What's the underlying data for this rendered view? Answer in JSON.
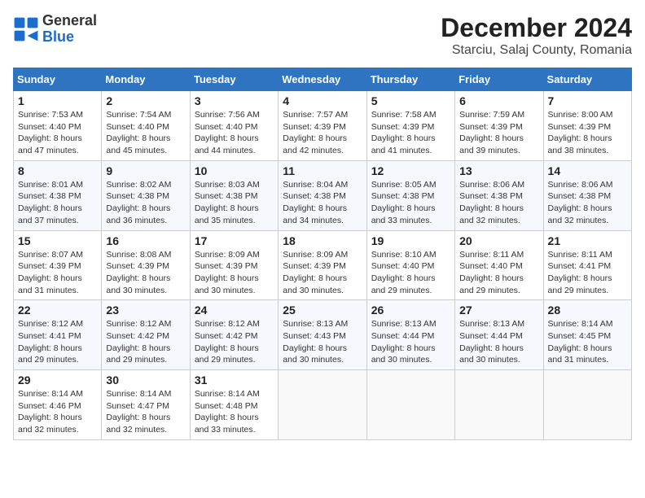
{
  "header": {
    "logo": {
      "line1": "General",
      "line2": "Blue"
    },
    "title": "December 2024",
    "subtitle": "Starciu, Salaj County, Romania"
  },
  "weekdays": [
    "Sunday",
    "Monday",
    "Tuesday",
    "Wednesday",
    "Thursday",
    "Friday",
    "Saturday"
  ],
  "weeks": [
    [
      {
        "day": 1,
        "info": "Sunrise: 7:53 AM\nSunset: 4:40 PM\nDaylight: 8 hours\nand 47 minutes."
      },
      {
        "day": 2,
        "info": "Sunrise: 7:54 AM\nSunset: 4:40 PM\nDaylight: 8 hours\nand 45 minutes."
      },
      {
        "day": 3,
        "info": "Sunrise: 7:56 AM\nSunset: 4:40 PM\nDaylight: 8 hours\nand 44 minutes."
      },
      {
        "day": 4,
        "info": "Sunrise: 7:57 AM\nSunset: 4:39 PM\nDaylight: 8 hours\nand 42 minutes."
      },
      {
        "day": 5,
        "info": "Sunrise: 7:58 AM\nSunset: 4:39 PM\nDaylight: 8 hours\nand 41 minutes."
      },
      {
        "day": 6,
        "info": "Sunrise: 7:59 AM\nSunset: 4:39 PM\nDaylight: 8 hours\nand 39 minutes."
      },
      {
        "day": 7,
        "info": "Sunrise: 8:00 AM\nSunset: 4:39 PM\nDaylight: 8 hours\nand 38 minutes."
      }
    ],
    [
      {
        "day": 8,
        "info": "Sunrise: 8:01 AM\nSunset: 4:38 PM\nDaylight: 8 hours\nand 37 minutes."
      },
      {
        "day": 9,
        "info": "Sunrise: 8:02 AM\nSunset: 4:38 PM\nDaylight: 8 hours\nand 36 minutes."
      },
      {
        "day": 10,
        "info": "Sunrise: 8:03 AM\nSunset: 4:38 PM\nDaylight: 8 hours\nand 35 minutes."
      },
      {
        "day": 11,
        "info": "Sunrise: 8:04 AM\nSunset: 4:38 PM\nDaylight: 8 hours\nand 34 minutes."
      },
      {
        "day": 12,
        "info": "Sunrise: 8:05 AM\nSunset: 4:38 PM\nDaylight: 8 hours\nand 33 minutes."
      },
      {
        "day": 13,
        "info": "Sunrise: 8:06 AM\nSunset: 4:38 PM\nDaylight: 8 hours\nand 32 minutes."
      },
      {
        "day": 14,
        "info": "Sunrise: 8:06 AM\nSunset: 4:38 PM\nDaylight: 8 hours\nand 32 minutes."
      }
    ],
    [
      {
        "day": 15,
        "info": "Sunrise: 8:07 AM\nSunset: 4:39 PM\nDaylight: 8 hours\nand 31 minutes."
      },
      {
        "day": 16,
        "info": "Sunrise: 8:08 AM\nSunset: 4:39 PM\nDaylight: 8 hours\nand 30 minutes."
      },
      {
        "day": 17,
        "info": "Sunrise: 8:09 AM\nSunset: 4:39 PM\nDaylight: 8 hours\nand 30 minutes."
      },
      {
        "day": 18,
        "info": "Sunrise: 8:09 AM\nSunset: 4:39 PM\nDaylight: 8 hours\nand 30 minutes."
      },
      {
        "day": 19,
        "info": "Sunrise: 8:10 AM\nSunset: 4:40 PM\nDaylight: 8 hours\nand 29 minutes."
      },
      {
        "day": 20,
        "info": "Sunrise: 8:11 AM\nSunset: 4:40 PM\nDaylight: 8 hours\nand 29 minutes."
      },
      {
        "day": 21,
        "info": "Sunrise: 8:11 AM\nSunset: 4:41 PM\nDaylight: 8 hours\nand 29 minutes."
      }
    ],
    [
      {
        "day": 22,
        "info": "Sunrise: 8:12 AM\nSunset: 4:41 PM\nDaylight: 8 hours\nand 29 minutes."
      },
      {
        "day": 23,
        "info": "Sunrise: 8:12 AM\nSunset: 4:42 PM\nDaylight: 8 hours\nand 29 minutes."
      },
      {
        "day": 24,
        "info": "Sunrise: 8:12 AM\nSunset: 4:42 PM\nDaylight: 8 hours\nand 29 minutes."
      },
      {
        "day": 25,
        "info": "Sunrise: 8:13 AM\nSunset: 4:43 PM\nDaylight: 8 hours\nand 30 minutes."
      },
      {
        "day": 26,
        "info": "Sunrise: 8:13 AM\nSunset: 4:44 PM\nDaylight: 8 hours\nand 30 minutes."
      },
      {
        "day": 27,
        "info": "Sunrise: 8:13 AM\nSunset: 4:44 PM\nDaylight: 8 hours\nand 30 minutes."
      },
      {
        "day": 28,
        "info": "Sunrise: 8:14 AM\nSunset: 4:45 PM\nDaylight: 8 hours\nand 31 minutes."
      }
    ],
    [
      {
        "day": 29,
        "info": "Sunrise: 8:14 AM\nSunset: 4:46 PM\nDaylight: 8 hours\nand 32 minutes."
      },
      {
        "day": 30,
        "info": "Sunrise: 8:14 AM\nSunset: 4:47 PM\nDaylight: 8 hours\nand 32 minutes."
      },
      {
        "day": 31,
        "info": "Sunrise: 8:14 AM\nSunset: 4:48 PM\nDaylight: 8 hours\nand 33 minutes."
      },
      null,
      null,
      null,
      null
    ]
  ]
}
